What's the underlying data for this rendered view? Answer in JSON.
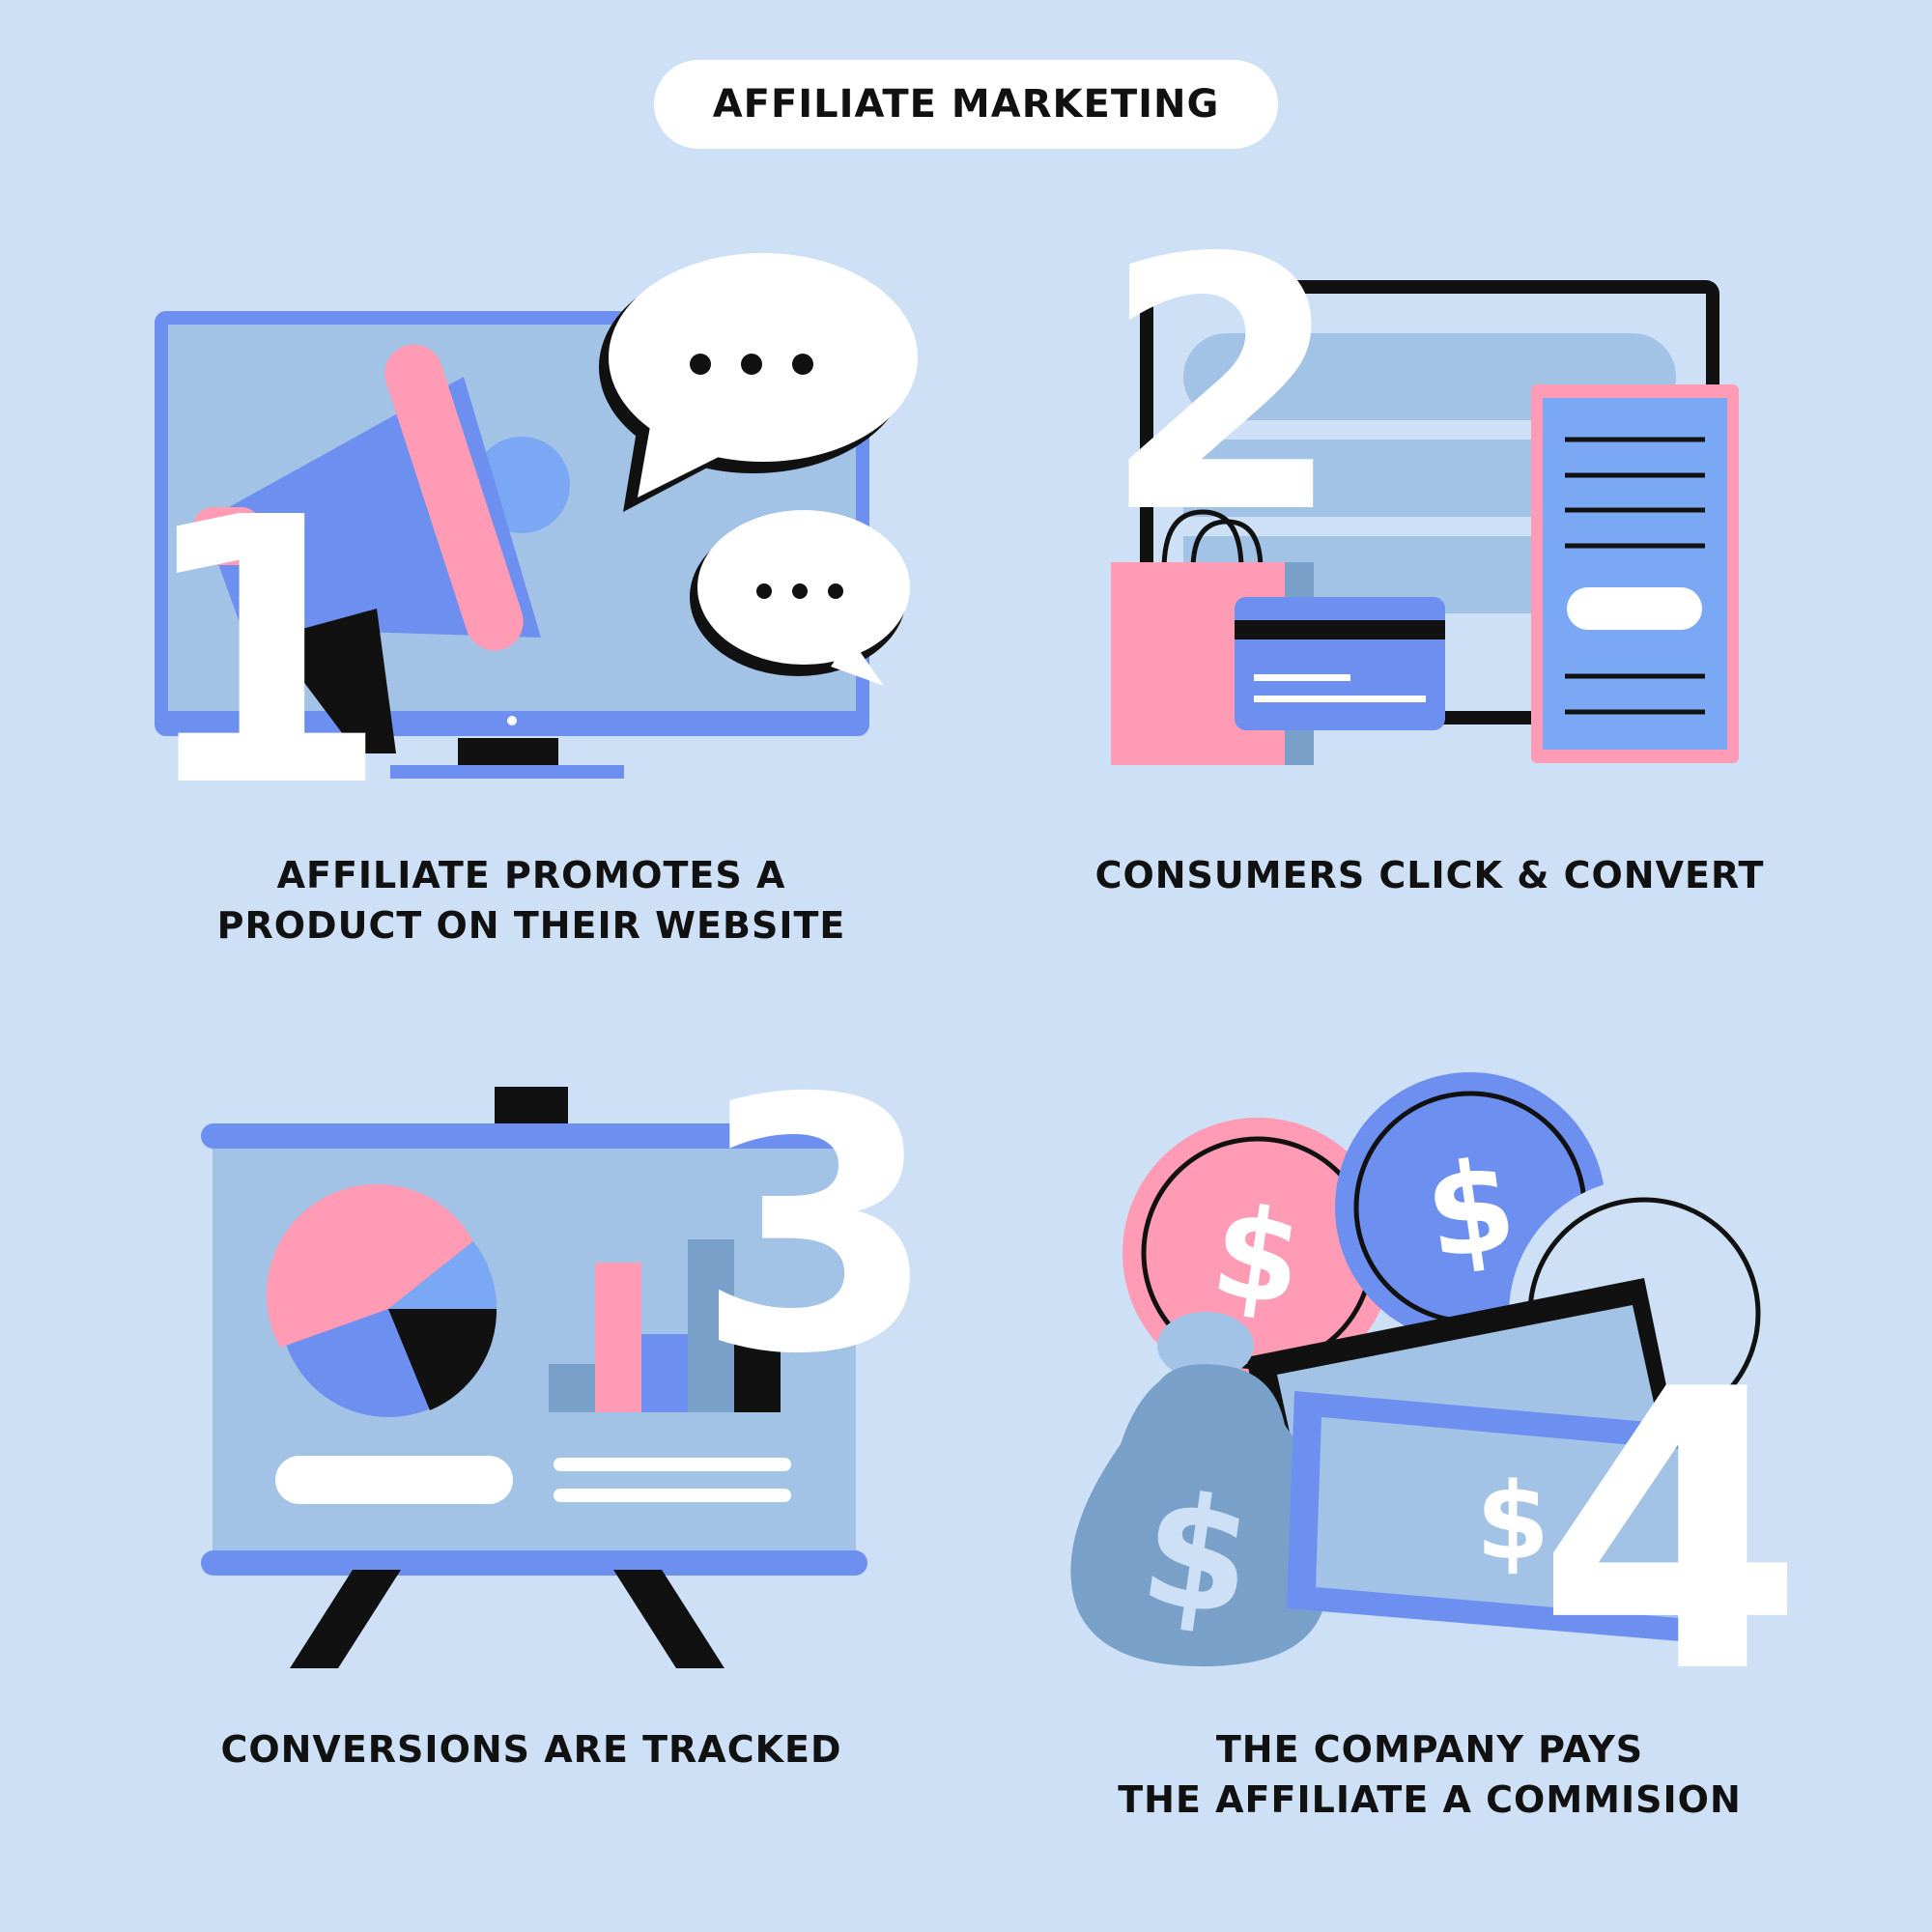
{
  "title": "AFFILIATE MARKETING",
  "steps": [
    {
      "number": "1",
      "caption_lines": [
        "AFFILIATE PROMOTES A",
        "PRODUCT ON THEIR WEBSITE"
      ],
      "illustration": "monitor-megaphone-speech-bubbles"
    },
    {
      "number": "2",
      "caption_lines": [
        "CONSUMERS CLICK & CONVERT"
      ],
      "illustration": "shopping-bag-credit-card-receipt"
    },
    {
      "number": "3",
      "caption_lines": [
        "CONVERSIONS ARE TRACKED"
      ],
      "illustration": "presentation-board-pie-bar-chart"
    },
    {
      "number": "4",
      "caption_lines": [
        "THE COMPANY PAYS",
        "THE AFFILIATE A COMMISION"
      ],
      "illustration": "coins-money-bag-banknotes"
    }
  ],
  "colors": {
    "background": "#cde0f5",
    "panel": "#a2c2e6",
    "blue": "#6d8ff0",
    "pink": "#ff9bb5",
    "steel": "#78a0c8",
    "black": "#111111",
    "white": "#ffffff"
  },
  "icons": {
    "dollar": "$",
    "ellipsis": "• • •"
  }
}
